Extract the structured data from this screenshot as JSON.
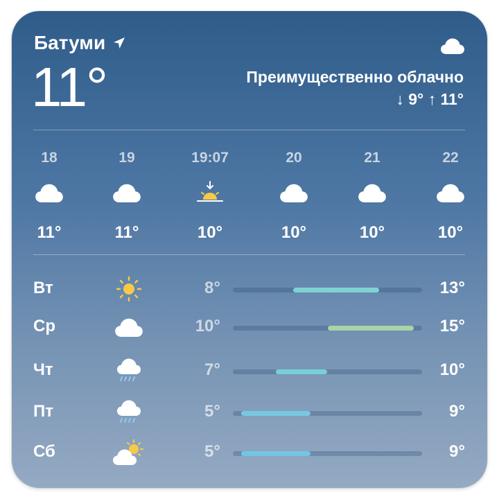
{
  "current": {
    "city": "Батуми",
    "location_icon": "location-arrow-icon",
    "temperature": "11°",
    "condition": "Преимущественно облачно",
    "low_high": "↓ 9° ↑ 11°",
    "icon": "cloud-icon"
  },
  "hourly": [
    {
      "time": "18",
      "icon": "cloud-icon",
      "temp": "11°"
    },
    {
      "time": "19",
      "icon": "cloud-icon",
      "temp": "11°"
    },
    {
      "time": "19:07",
      "icon": "sunset-icon",
      "temp": "10°"
    },
    {
      "time": "20",
      "icon": "cloud-icon",
      "temp": "10°"
    },
    {
      "time": "21",
      "icon": "cloud-icon",
      "temp": "10°"
    },
    {
      "time": "22",
      "icon": "cloud-icon",
      "temp": "10°"
    }
  ],
  "daily": [
    {
      "day": "Вт",
      "icon": "sun-icon",
      "low": "8°",
      "high": "13°",
      "low_value": 8,
      "high_value": 13,
      "bar_color": "#7ed3d0"
    },
    {
      "day": "Ср",
      "icon": "cloud-icon",
      "low": "10°",
      "high": "15°",
      "low_value": 10,
      "high_value": 15,
      "bar_color": "#a9d4a6"
    },
    {
      "day": "Чт",
      "icon": "rain-cloud-icon",
      "low": "7°",
      "high": "10°",
      "low_value": 7,
      "high_value": 10,
      "bar_color": "#79cfd8"
    },
    {
      "day": "Пт",
      "icon": "rain-cloud-icon",
      "low": "5°",
      "high": "9°",
      "low_value": 5,
      "high_value": 9,
      "bar_color": "#76c8e0"
    },
    {
      "day": "Сб",
      "icon": "partly-sunny-icon",
      "low": "5°",
      "high": "9°",
      "low_value": 5,
      "high_value": 9,
      "bar_color": "#72c6e4"
    }
  ],
  "range_scale": [
    4.5,
    15.5
  ],
  "colors": {
    "sun": "#f7c948",
    "cloud": "#ffffff",
    "rain": "#8ecdf5"
  }
}
